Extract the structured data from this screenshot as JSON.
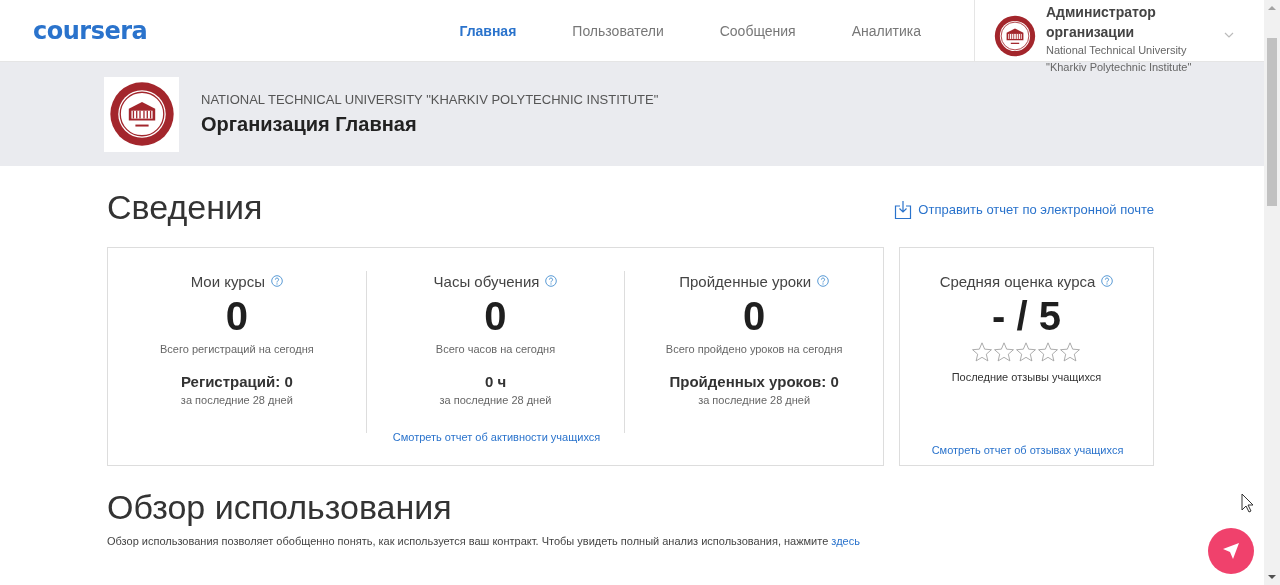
{
  "header": {
    "logo": "coursera",
    "nav": [
      {
        "label": "Главная",
        "selected": true
      },
      {
        "label": "Пользователи",
        "selected": false
      },
      {
        "label": "Сообщения",
        "selected": false
      },
      {
        "label": "Аналитика",
        "selected": false
      }
    ],
    "profile": {
      "role": "Администратор организации",
      "org": "National Technical University \"Kharkiv Polytechnic Institute\""
    }
  },
  "banner": {
    "org_name": "NATIONAL TECHNICAL UNIVERSITY \"KHARKIV POLYTECHNIC INSTITUTE\"",
    "title": "Организация Главная"
  },
  "summary": {
    "heading": "Сведения",
    "email_link": "Отправить отчет по электронной почте",
    "stats": [
      {
        "title": "Мои курсы",
        "value": "0",
        "caption": "Всего регистраций на сегодня",
        "period_value": "Регистраций: 0",
        "period_caption": "за последние 28 дней"
      },
      {
        "title": "Часы обучения",
        "value": "0",
        "caption": "Всего часов на сегодня",
        "period_value": "0 ч",
        "period_caption": "за последние 28 дней"
      },
      {
        "title": "Пройденные уроки",
        "value": "0",
        "caption": "Всего пройдено уроков на сегодня",
        "period_value": "Пройденных уроков: 0",
        "period_caption": "за последние 28 дней"
      }
    ],
    "activity_link": "Смотреть отчет об активности учащихся",
    "rating": {
      "title": "Средняя оценка курса",
      "value": "- / 5",
      "stars": 0,
      "caption": "Последние отзывы учащихся",
      "link": "Смотреть отчет об отзывах учащихся"
    }
  },
  "usage": {
    "heading": "Обзор использования",
    "description": "Обзор использования позволяет обобщенно понять, как используется ваш контракт. Чтобы увидеть полный анализ использования, нажмите ",
    "link": "здесь"
  }
}
